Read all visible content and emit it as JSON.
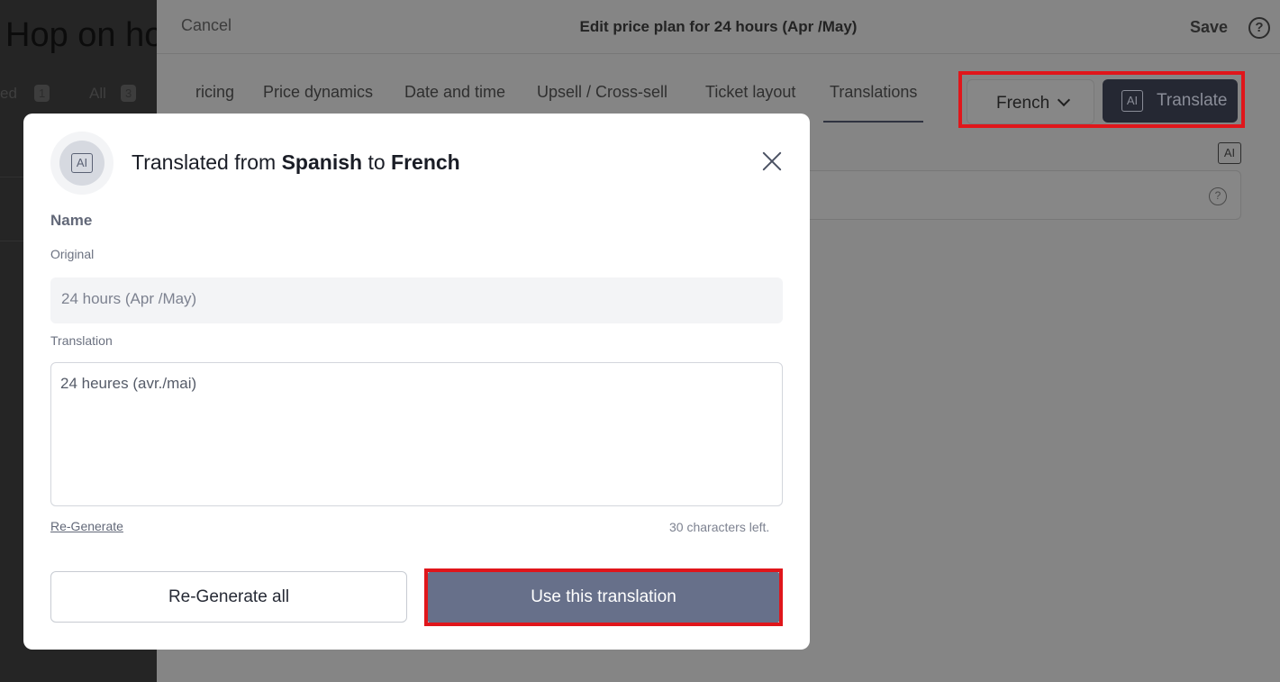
{
  "background_page": {
    "title": "Hop on ho",
    "tabs": [
      {
        "label": "ed",
        "count": "1"
      },
      {
        "label": "All",
        "count": "3"
      }
    ]
  },
  "panel": {
    "cancel_label": "Cancel",
    "title": "Edit price plan for 24 hours (Apr /May)",
    "save_label": "Save",
    "help_icon": "?",
    "tabs": [
      {
        "label": "ricing"
      },
      {
        "label": "Price dynamics"
      },
      {
        "label": "Date and time"
      },
      {
        "label": "Upsell / Cross-sell"
      },
      {
        "label": "Ticket layout"
      },
      {
        "label": "Translations",
        "active": true
      }
    ],
    "language_select": {
      "value": "French"
    },
    "translate_button": {
      "icon_text": "AI",
      "label": "Translate"
    },
    "ai_icon_text": "AI",
    "field_help_icon": "?"
  },
  "modal": {
    "ai_icon_text": "AI",
    "title": {
      "prefix": "Translated from ",
      "source": "Spanish",
      "middle": " to ",
      "target": "French"
    },
    "section_label": "Name",
    "original_label": "Original",
    "original_value": "24 hours (Apr /May)",
    "translation_label": "Translation",
    "translation_value": "24 heures (avr./mai)",
    "regenerate_label": "Re-Generate",
    "chars_left": "30 characters left.",
    "regenerate_all_label": "Re-Generate all",
    "use_translation_label": "Use this translation"
  },
  "colors": {
    "highlight": "#e0161b",
    "primary_button": "#67708a",
    "dark_button": "#252833"
  }
}
